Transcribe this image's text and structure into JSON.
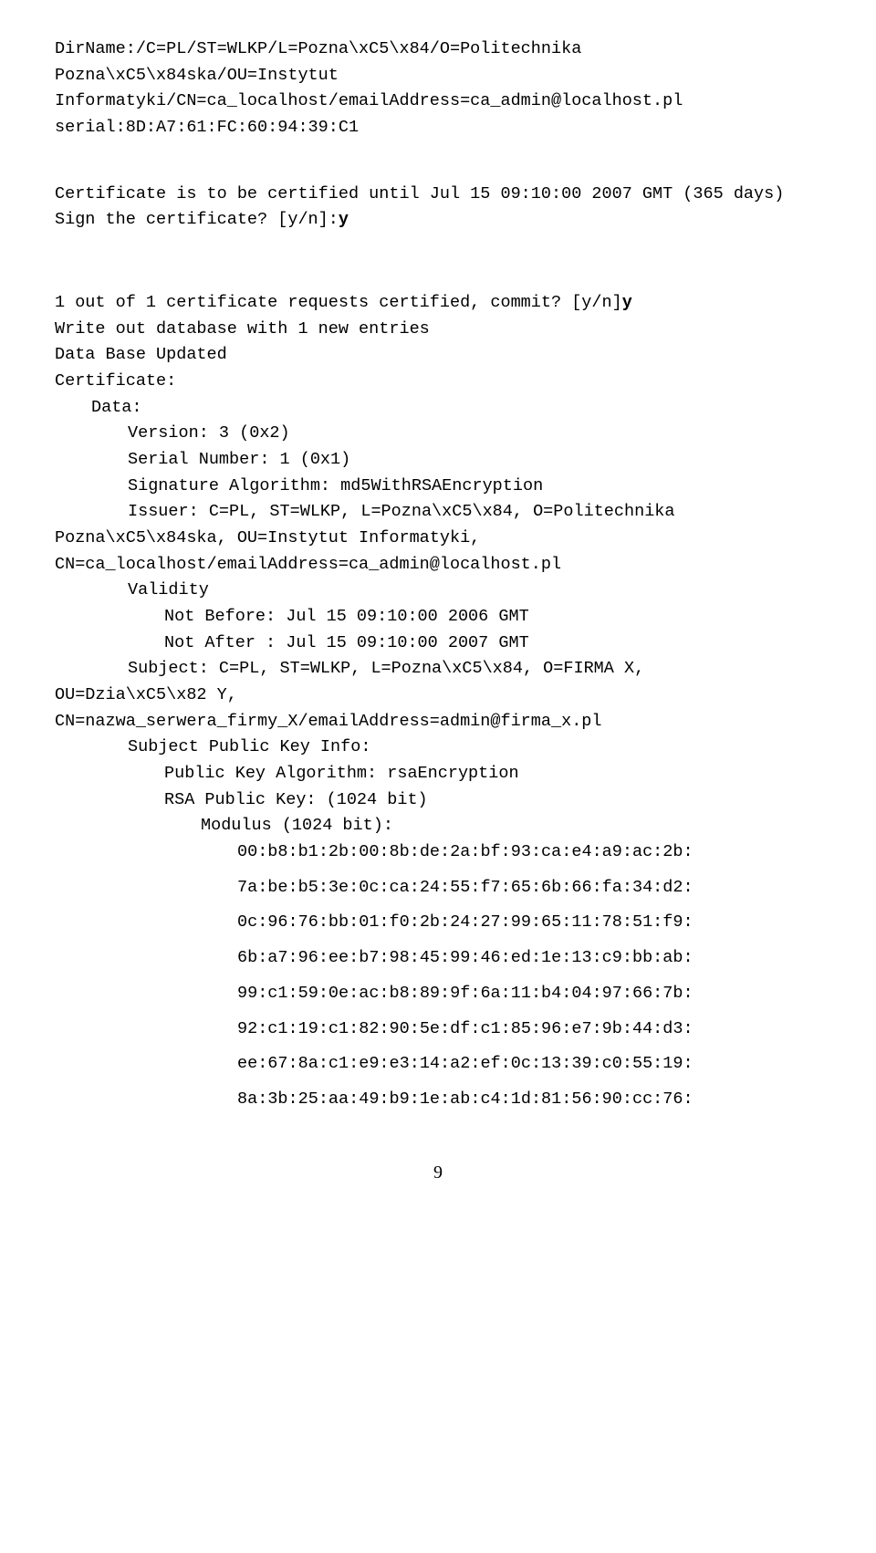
{
  "line1": "DirName:/C=PL/ST=WLKP/L=Pozna\\xC5\\x84/O=Politechnika Pozna\\xC5\\x84ska/OU=Instytut Informatyki/CN=ca_localhost/emailAddress=ca_admin@localhost.pl",
  "line2": "serial:8D:A7:61:FC:60:94:39:C1",
  "line3": "Certificate is to be certified until Jul 15 09:10:00 2007 GMT (365 days)",
  "line4a": "Sign the certificate? [y/n]:",
  "line4b": "y",
  "line5a": "1 out of 1 certificate requests certified, commit? [y/n]",
  "line5b": "y",
  "line6": "Write out database with 1 new entries",
  "line7": "Data Base Updated",
  "line8": "Certificate:",
  "line9": "Data:",
  "line10": "Version: 3 (0x2)",
  "line11": "Serial Number: 1 (0x1)",
  "line12": "Signature Algorithm: md5WithRSAEncryption",
  "line13": "Issuer: C=PL, ST=WLKP, L=Pozna\\xC5\\x84, O=Politechnika Pozna\\xC5\\x84ska, OU=Instytut Informatyki, CN=ca_localhost/emailAddress=ca_admin@localhost.pl",
  "line14": "Validity",
  "line15": "Not Before: Jul 15 09:10:00 2006 GMT",
  "line16": "Not After : Jul 15 09:10:00 2007 GMT",
  "line17": "Subject: C=PL, ST=WLKP, L=Pozna\\xC5\\x84, O=FIRMA X, OU=Dzia\\xC5\\x82 Y, CN=nazwa_serwera_firmy_X/emailAddress=admin@firma_x.pl",
  "line18": "Subject Public Key Info:",
  "line19": "Public Key Algorithm: rsaEncryption",
  "line20": "RSA Public Key: (1024 bit)",
  "line21": "Modulus (1024 bit):",
  "mod": [
    "00:b8:b1:2b:00:8b:de:2a:bf:93:ca:e4:a9:ac:2b:",
    "7a:be:b5:3e:0c:ca:24:55:f7:65:6b:66:fa:34:d2:",
    "0c:96:76:bb:01:f0:2b:24:27:99:65:11:78:51:f9:",
    "6b:a7:96:ee:b7:98:45:99:46:ed:1e:13:c9:bb:ab:",
    "99:c1:59:0e:ac:b8:89:9f:6a:11:b4:04:97:66:7b:",
    "92:c1:19:c1:82:90:5e:df:c1:85:96:e7:9b:44:d3:",
    "ee:67:8a:c1:e9:e3:14:a2:ef:0c:13:39:c0:55:19:",
    "8a:3b:25:aa:49:b9:1e:ab:c4:1d:81:56:90:cc:76:"
  ],
  "pagenum": "9"
}
